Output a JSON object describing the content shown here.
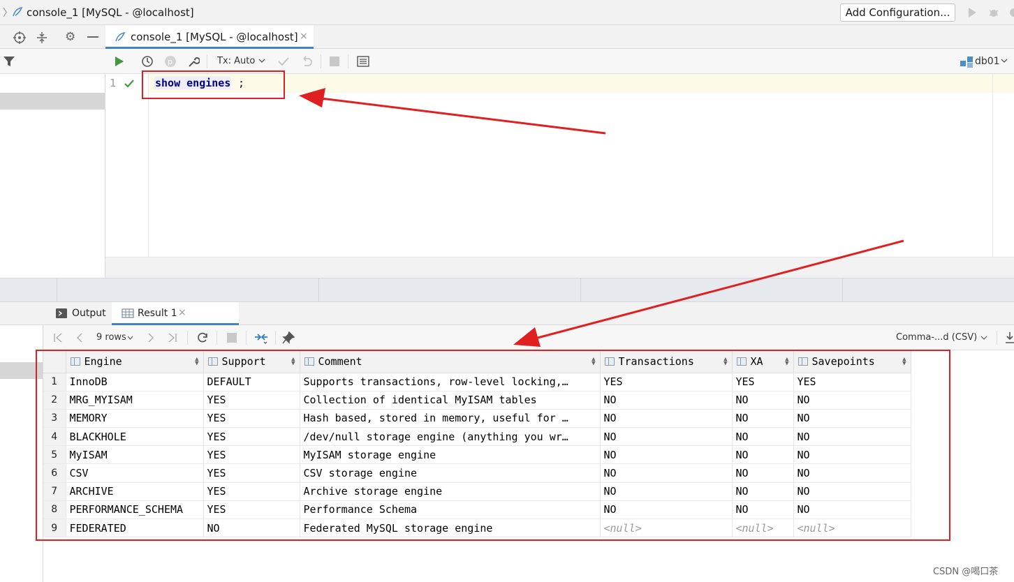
{
  "window": {
    "title": "console_1 [MySQL - @localhost]",
    "add_config_label": "Add Configuration..."
  },
  "editor_tab": {
    "label": "console_1 [MySQL - @localhost]",
    "close": "×"
  },
  "editor_toolbar": {
    "tx_mode": "Tx: Auto",
    "datasource": "db01"
  },
  "editor": {
    "line_number": "1",
    "code_keyword": "show engines",
    "code_semicolon": ";"
  },
  "results": {
    "tabs": [
      {
        "label": "Output"
      },
      {
        "label": "Result 1",
        "close": "×"
      }
    ],
    "row_count": "9 rows",
    "export_format": "Comma-...d (CSV)",
    "columns": [
      "Engine",
      "Support",
      "Comment",
      "Transactions",
      "XA",
      "Savepoints"
    ],
    "rows": [
      {
        "n": "1",
        "engine": "InnoDB",
        "support": "DEFAULT",
        "comment": "Supports transactions, row-level locking,…",
        "transactions": "YES",
        "xa": "YES",
        "savepoints": "YES"
      },
      {
        "n": "2",
        "engine": "MRG_MYISAM",
        "support": "YES",
        "comment": "Collection of identical MyISAM tables",
        "transactions": "NO",
        "xa": "NO",
        "savepoints": "NO"
      },
      {
        "n": "3",
        "engine": "MEMORY",
        "support": "YES",
        "comment": "Hash based, stored in memory, useful for …",
        "transactions": "NO",
        "xa": "NO",
        "savepoints": "NO"
      },
      {
        "n": "4",
        "engine": "BLACKHOLE",
        "support": "YES",
        "comment": "/dev/null storage engine (anything you wr…",
        "transactions": "NO",
        "xa": "NO",
        "savepoints": "NO"
      },
      {
        "n": "5",
        "engine": "MyISAM",
        "support": "YES",
        "comment": "MyISAM storage engine",
        "transactions": "NO",
        "xa": "NO",
        "savepoints": "NO"
      },
      {
        "n": "6",
        "engine": "CSV",
        "support": "YES",
        "comment": "CSV storage engine",
        "transactions": "NO",
        "xa": "NO",
        "savepoints": "NO"
      },
      {
        "n": "7",
        "engine": "ARCHIVE",
        "support": "YES",
        "comment": "Archive storage engine",
        "transactions": "NO",
        "xa": "NO",
        "savepoints": "NO"
      },
      {
        "n": "8",
        "engine": "PERFORMANCE_SCHEMA",
        "support": "YES",
        "comment": "Performance Schema",
        "transactions": "NO",
        "xa": "NO",
        "savepoints": "NO"
      },
      {
        "n": "9",
        "engine": "FEDERATED",
        "support": "NO",
        "comment": "Federated MySQL storage engine",
        "transactions": "<null>",
        "xa": "<null>",
        "savepoints": "<null>"
      }
    ]
  },
  "watermark": "CSDN @喝口茶",
  "colors": {
    "accent": "#4083c9",
    "annotation": "#e02020",
    "run_green": "#3f9b3f",
    "keyword": "#000080"
  }
}
